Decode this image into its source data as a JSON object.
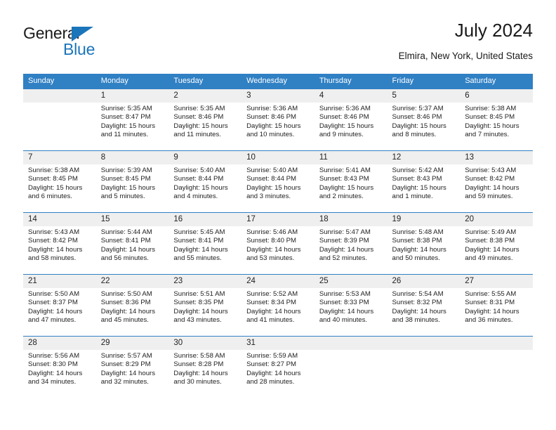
{
  "brand": {
    "name_top": "General",
    "name_bottom": "Blue",
    "triangle_icon": "blue-triangle-icon",
    "accent_color": "#1b75bb"
  },
  "header": {
    "title": "July 2024",
    "subtitle": "Elmira, New York, United States"
  },
  "theme": {
    "header_bg": "#3080c4",
    "header_text": "#ffffff",
    "daynum_bg": "#efefef",
    "cell_bg": "#ffffff",
    "text": "#222222"
  },
  "weekday_headers": [
    "Sunday",
    "Monday",
    "Tuesday",
    "Wednesday",
    "Thursday",
    "Friday",
    "Saturday"
  ],
  "weeks": [
    [
      {
        "day": "",
        "sunrise": "",
        "sunset": "",
        "daylight1": "",
        "daylight2": "",
        "empty": true
      },
      {
        "day": "1",
        "sunrise": "Sunrise: 5:35 AM",
        "sunset": "Sunset: 8:47 PM",
        "daylight1": "Daylight: 15 hours",
        "daylight2": "and 11 minutes."
      },
      {
        "day": "2",
        "sunrise": "Sunrise: 5:35 AM",
        "sunset": "Sunset: 8:46 PM",
        "daylight1": "Daylight: 15 hours",
        "daylight2": "and 11 minutes."
      },
      {
        "day": "3",
        "sunrise": "Sunrise: 5:36 AM",
        "sunset": "Sunset: 8:46 PM",
        "daylight1": "Daylight: 15 hours",
        "daylight2": "and 10 minutes."
      },
      {
        "day": "4",
        "sunrise": "Sunrise: 5:36 AM",
        "sunset": "Sunset: 8:46 PM",
        "daylight1": "Daylight: 15 hours",
        "daylight2": "and 9 minutes."
      },
      {
        "day": "5",
        "sunrise": "Sunrise: 5:37 AM",
        "sunset": "Sunset: 8:46 PM",
        "daylight1": "Daylight: 15 hours",
        "daylight2": "and 8 minutes."
      },
      {
        "day": "6",
        "sunrise": "Sunrise: 5:38 AM",
        "sunset": "Sunset: 8:45 PM",
        "daylight1": "Daylight: 15 hours",
        "daylight2": "and 7 minutes."
      }
    ],
    [
      {
        "day": "7",
        "sunrise": "Sunrise: 5:38 AM",
        "sunset": "Sunset: 8:45 PM",
        "daylight1": "Daylight: 15 hours",
        "daylight2": "and 6 minutes."
      },
      {
        "day": "8",
        "sunrise": "Sunrise: 5:39 AM",
        "sunset": "Sunset: 8:45 PM",
        "daylight1": "Daylight: 15 hours",
        "daylight2": "and 5 minutes."
      },
      {
        "day": "9",
        "sunrise": "Sunrise: 5:40 AM",
        "sunset": "Sunset: 8:44 PM",
        "daylight1": "Daylight: 15 hours",
        "daylight2": "and 4 minutes."
      },
      {
        "day": "10",
        "sunrise": "Sunrise: 5:40 AM",
        "sunset": "Sunset: 8:44 PM",
        "daylight1": "Daylight: 15 hours",
        "daylight2": "and 3 minutes."
      },
      {
        "day": "11",
        "sunrise": "Sunrise: 5:41 AM",
        "sunset": "Sunset: 8:43 PM",
        "daylight1": "Daylight: 15 hours",
        "daylight2": "and 2 minutes."
      },
      {
        "day": "12",
        "sunrise": "Sunrise: 5:42 AM",
        "sunset": "Sunset: 8:43 PM",
        "daylight1": "Daylight: 15 hours",
        "daylight2": "and 1 minute."
      },
      {
        "day": "13",
        "sunrise": "Sunrise: 5:43 AM",
        "sunset": "Sunset: 8:42 PM",
        "daylight1": "Daylight: 14 hours",
        "daylight2": "and 59 minutes."
      }
    ],
    [
      {
        "day": "14",
        "sunrise": "Sunrise: 5:43 AM",
        "sunset": "Sunset: 8:42 PM",
        "daylight1": "Daylight: 14 hours",
        "daylight2": "and 58 minutes."
      },
      {
        "day": "15",
        "sunrise": "Sunrise: 5:44 AM",
        "sunset": "Sunset: 8:41 PM",
        "daylight1": "Daylight: 14 hours",
        "daylight2": "and 56 minutes."
      },
      {
        "day": "16",
        "sunrise": "Sunrise: 5:45 AM",
        "sunset": "Sunset: 8:41 PM",
        "daylight1": "Daylight: 14 hours",
        "daylight2": "and 55 minutes."
      },
      {
        "day": "17",
        "sunrise": "Sunrise: 5:46 AM",
        "sunset": "Sunset: 8:40 PM",
        "daylight1": "Daylight: 14 hours",
        "daylight2": "and 53 minutes."
      },
      {
        "day": "18",
        "sunrise": "Sunrise: 5:47 AM",
        "sunset": "Sunset: 8:39 PM",
        "daylight1": "Daylight: 14 hours",
        "daylight2": "and 52 minutes."
      },
      {
        "day": "19",
        "sunrise": "Sunrise: 5:48 AM",
        "sunset": "Sunset: 8:38 PM",
        "daylight1": "Daylight: 14 hours",
        "daylight2": "and 50 minutes."
      },
      {
        "day": "20",
        "sunrise": "Sunrise: 5:49 AM",
        "sunset": "Sunset: 8:38 PM",
        "daylight1": "Daylight: 14 hours",
        "daylight2": "and 49 minutes."
      }
    ],
    [
      {
        "day": "21",
        "sunrise": "Sunrise: 5:50 AM",
        "sunset": "Sunset: 8:37 PM",
        "daylight1": "Daylight: 14 hours",
        "daylight2": "and 47 minutes."
      },
      {
        "day": "22",
        "sunrise": "Sunrise: 5:50 AM",
        "sunset": "Sunset: 8:36 PM",
        "daylight1": "Daylight: 14 hours",
        "daylight2": "and 45 minutes."
      },
      {
        "day": "23",
        "sunrise": "Sunrise: 5:51 AM",
        "sunset": "Sunset: 8:35 PM",
        "daylight1": "Daylight: 14 hours",
        "daylight2": "and 43 minutes."
      },
      {
        "day": "24",
        "sunrise": "Sunrise: 5:52 AM",
        "sunset": "Sunset: 8:34 PM",
        "daylight1": "Daylight: 14 hours",
        "daylight2": "and 41 minutes."
      },
      {
        "day": "25",
        "sunrise": "Sunrise: 5:53 AM",
        "sunset": "Sunset: 8:33 PM",
        "daylight1": "Daylight: 14 hours",
        "daylight2": "and 40 minutes."
      },
      {
        "day": "26",
        "sunrise": "Sunrise: 5:54 AM",
        "sunset": "Sunset: 8:32 PM",
        "daylight1": "Daylight: 14 hours",
        "daylight2": "and 38 minutes."
      },
      {
        "day": "27",
        "sunrise": "Sunrise: 5:55 AM",
        "sunset": "Sunset: 8:31 PM",
        "daylight1": "Daylight: 14 hours",
        "daylight2": "and 36 minutes."
      }
    ],
    [
      {
        "day": "28",
        "sunrise": "Sunrise: 5:56 AM",
        "sunset": "Sunset: 8:30 PM",
        "daylight1": "Daylight: 14 hours",
        "daylight2": "and 34 minutes."
      },
      {
        "day": "29",
        "sunrise": "Sunrise: 5:57 AM",
        "sunset": "Sunset: 8:29 PM",
        "daylight1": "Daylight: 14 hours",
        "daylight2": "and 32 minutes."
      },
      {
        "day": "30",
        "sunrise": "Sunrise: 5:58 AM",
        "sunset": "Sunset: 8:28 PM",
        "daylight1": "Daylight: 14 hours",
        "daylight2": "and 30 minutes."
      },
      {
        "day": "31",
        "sunrise": "Sunrise: 5:59 AM",
        "sunset": "Sunset: 8:27 PM",
        "daylight1": "Daylight: 14 hours",
        "daylight2": "and 28 minutes."
      },
      {
        "day": "",
        "sunrise": "",
        "sunset": "",
        "daylight1": "",
        "daylight2": "",
        "empty": true
      },
      {
        "day": "",
        "sunrise": "",
        "sunset": "",
        "daylight1": "",
        "daylight2": "",
        "empty": true
      },
      {
        "day": "",
        "sunrise": "",
        "sunset": "",
        "daylight1": "",
        "daylight2": "",
        "empty": true
      }
    ]
  ]
}
